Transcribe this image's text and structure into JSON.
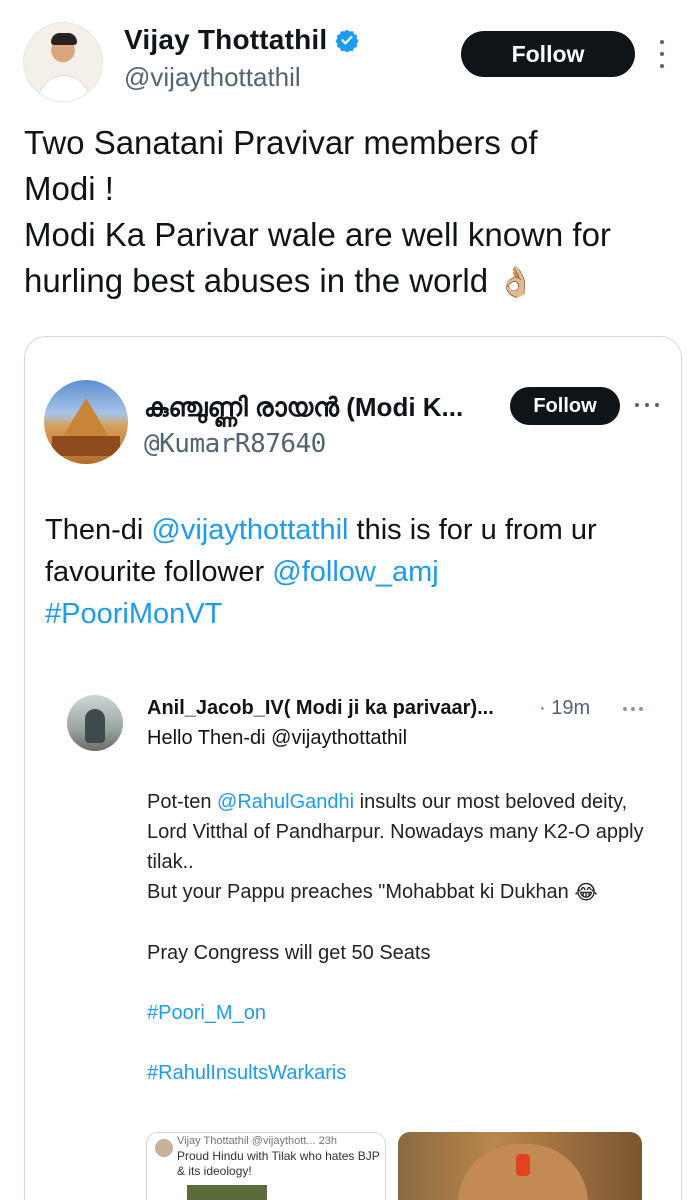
{
  "tweet": {
    "author_name": "Vijay Thottathil",
    "author_handle": "@vijaythottathil",
    "follow_label": "Follow",
    "text_lines": [
      "Two Sanatani Pravivar members of",
      "Modi !",
      "Modi Ka Parivar wale are well known for",
      "hurling best abuses in the world"
    ],
    "emoji": "👌🏼"
  },
  "quote": {
    "name": "കുഞ്ചുണ്ണി രായൻ (Modi K...",
    "handle": "@KumarR87640",
    "follow_label": "Follow",
    "text_prefix": "Then-di ",
    "mention1": "@vijaythottathil",
    "text_mid": " this is for u from ur favourite follower ",
    "mention2": "@follow_amj",
    "hashtag": "#PooriMonVT"
  },
  "nested": {
    "name": "Anil_Jacob_IV( Modi ji ka parivaar)...",
    "time": "· 19m",
    "reply_line": "Hello Then-di @vijaythottathil",
    "body_prefix": "Pot-ten ",
    "mention": "@RahulGandhi",
    "body_rest": " insults our most beloved deity, Lord Vitthal of Pandharpur. Nowadays many K2-O apply tilak..",
    "body_line2": "But your Pappu preaches \"Mohabbat ki Dukhan",
    "emoji": "😂",
    "body_line3": "Pray Congress will get 50 Seats",
    "hashtag1": "#Poori_M_on",
    "hashtag2": "#RahulInsultsWarkaris"
  },
  "media_left": {
    "line1": "Vijay Thottathil @vijaythott... 23h",
    "line2": "Proud Hindu with Tilak who hates BJP & its ideology!"
  },
  "colors": {
    "link": "#1d9bf0",
    "text": "#0f1419",
    "muted": "#536471",
    "button": "#0f1419",
    "verified": "#1d9bf0"
  }
}
